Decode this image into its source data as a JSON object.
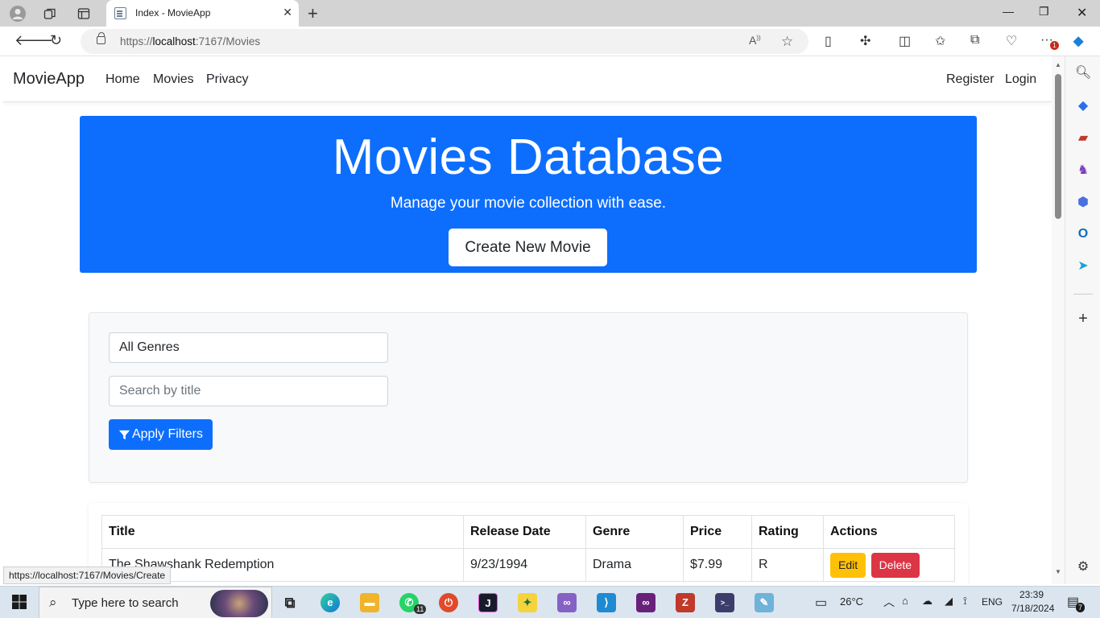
{
  "browser": {
    "tab_title": "Index - MovieApp",
    "url_prefix": "https://",
    "url_host": "localhost",
    "url_path": ":7167/Movies",
    "status_url": "https://localhost:7167/Movies/Create",
    "notification_count": "1"
  },
  "site": {
    "brand": "MovieApp",
    "nav": [
      "Home",
      "Movies",
      "Privacy"
    ],
    "auth": [
      "Register",
      "Login"
    ]
  },
  "hero": {
    "title": "Movies Database",
    "subtitle": "Manage your movie collection with ease.",
    "cta": "Create New Movie"
  },
  "filters": {
    "genre_value": "All Genres",
    "search_placeholder": "Search by title",
    "apply_label": "Apply Filters"
  },
  "table": {
    "headers": [
      "Title",
      "Release Date",
      "Genre",
      "Price",
      "Rating",
      "Actions"
    ],
    "rows": [
      {
        "title": "The Shawshank Redemption",
        "release_date": "9/23/1994",
        "genre": "Drama",
        "price": "$7.99",
        "rating": "R",
        "edit": "Edit",
        "delete": "Delete"
      }
    ]
  },
  "taskbar": {
    "search_text": "Type here to search",
    "whatsapp_badge": "11",
    "temperature": "26°C",
    "language": "ENG",
    "time": "23:39",
    "date": "7/18/2024",
    "notification_badge": "7"
  },
  "colors": {
    "primary": "#0d6efd",
    "warning": "#ffc107",
    "danger": "#dc3545",
    "light": "#f8f9fa"
  }
}
